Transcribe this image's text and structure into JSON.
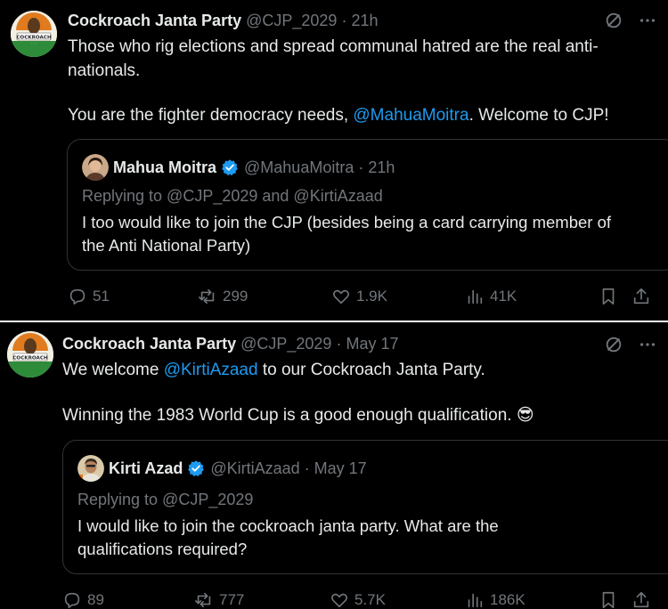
{
  "tweets": [
    {
      "author": "Cockroach Janta Party",
      "handle": "@CJP_2029",
      "time": "· 21h",
      "line1": "Those who rig elections and spread communal hatred are the real anti-",
      "line2": "nationals.",
      "line3_pre": "You are the fighter democracy needs, ",
      "line3_mention": "@MahuaMoitra",
      "line3_post": ". Welcome to CJP!",
      "avatar_text": "COCKROACH",
      "quote": {
        "author": "Mahua Moitra",
        "handle": "@MahuaMoitra",
        "time": "· 21h",
        "replying": "Replying to @CJP_2029 and @KirtiAzaad",
        "line1": "I too would like to join the CJP (besides being a card carrying member of",
        "line2": "the Anti National Party)"
      },
      "stats": {
        "replies": "51",
        "reposts": "299",
        "likes": "1.9K",
        "views": "41K"
      }
    },
    {
      "author": "Cockroach Janta Party",
      "handle": "@CJP_2029",
      "time": "· May 17",
      "line1_pre": "We welcome ",
      "line1_mention": "@KirtiAzaad",
      "line1_post": " to our Cockroach Janta Party.",
      "line2": "Winning the 1983 World Cup is a good enough qualification. 😎",
      "avatar_text": "COCKROACH",
      "quote": {
        "author": "Kirti Azad",
        "handle": "@KirtiAzaad",
        "time": "· May 17",
        "replying": "Replying to @CJP_2029",
        "line1": "I would like to join the cockroach janta party. What are the",
        "line2": "qualifications required?"
      },
      "stats": {
        "replies": "89",
        "reposts": "777",
        "likes": "5.7K",
        "views": "186K"
      }
    }
  ],
  "colors": {
    "background": "#000000",
    "text": "#e7e9ea",
    "muted": "#71767b",
    "link": "#1d9bf0",
    "border": "#2f3336",
    "verified": "#1d9bf0"
  },
  "icons": [
    "grok-icon",
    "more-icon",
    "reply-icon",
    "repost-icon",
    "like-icon",
    "views-icon",
    "bookmark-icon",
    "share-icon",
    "verified-badge-icon"
  ]
}
